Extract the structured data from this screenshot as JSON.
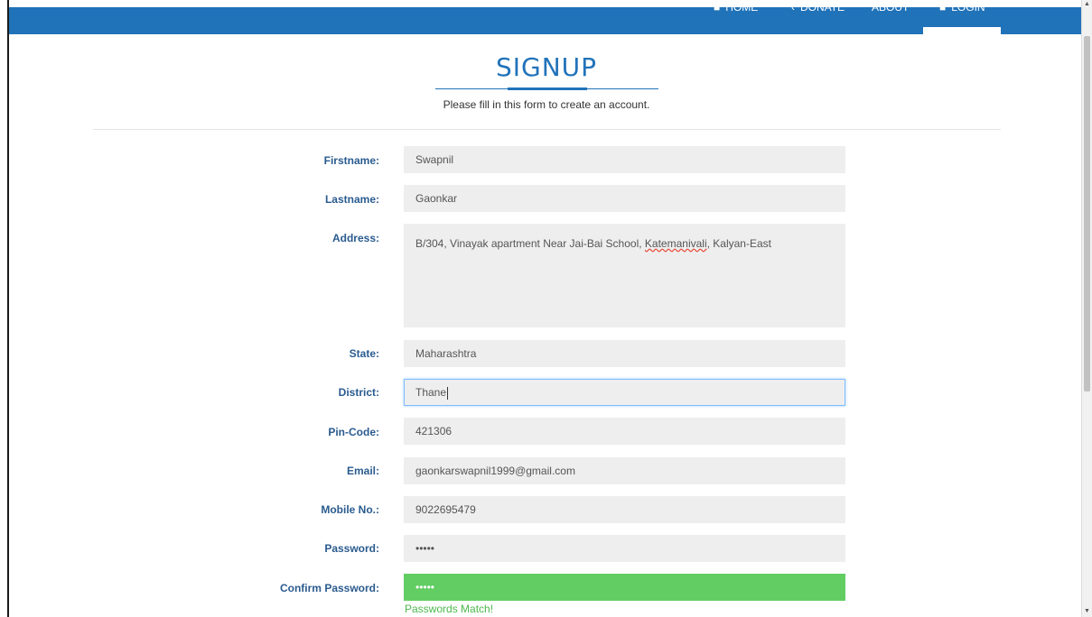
{
  "nav": {
    "home_label": "HOME",
    "donate_label": "DONATE",
    "about_label": "ABOUT",
    "login_label": "LOGIN"
  },
  "form": {
    "title": "SIGNUP",
    "subtitle": "Please fill in this form to create an account.",
    "firstname": {
      "label": "Firstname:",
      "value": "Swapnil"
    },
    "lastname": {
      "label": "Lastname:",
      "value": "Gaonkar"
    },
    "address": {
      "label": "Address:",
      "value_prefix": "B/304, Vinayak apartment Near Jai-Bai School, ",
      "value_misspelled": "Katemanivali",
      "value_suffix": ", Kalyan-East"
    },
    "state": {
      "label": "State:",
      "value": "Maharashtra"
    },
    "district": {
      "label": "District:",
      "value": "Thane"
    },
    "pincode": {
      "label": "Pin-Code:",
      "value": "421306"
    },
    "email": {
      "label": "Email:",
      "value": "gaonkarswapnil1999@gmail.com"
    },
    "mobile": {
      "label": "Mobile No.:",
      "value": "9022695479"
    },
    "password": {
      "label": "Password:",
      "value": "•••••"
    },
    "confirm_password": {
      "label": "Confirm Password:",
      "value": "•••••"
    },
    "match_message": "Passwords Match!"
  },
  "colors": {
    "primary": "#2173b9",
    "label": "#2a5b8f",
    "field_bg": "#eeeeee",
    "match_green": "#62cd63"
  }
}
